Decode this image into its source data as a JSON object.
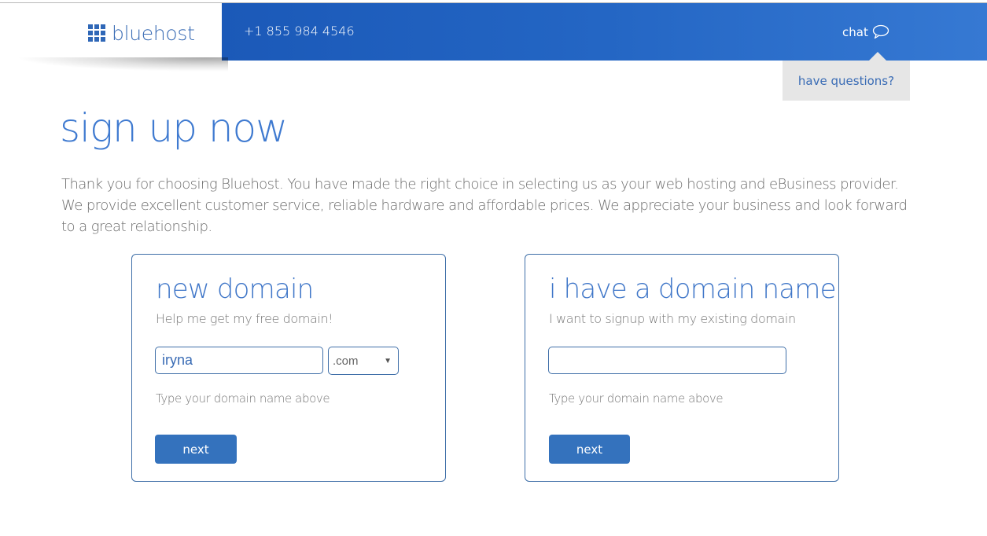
{
  "header": {
    "logo_text": "bluehost",
    "phone": "+1 855 984 4546",
    "chat_label": "chat",
    "chat_icon": "speech-bubble-icon",
    "questions_label": "have questions?"
  },
  "main": {
    "title": "sign up now",
    "intro": "Thank you for choosing Bluehost. You have made the right choice in selecting us as your web hosting and eBusiness provider. We provide excellent customer service, reliable hardware and affordable prices. We appreciate your business and look forward to a great relationship."
  },
  "cards": [
    {
      "title": "new domain",
      "subtitle": "Help me get my free domain!",
      "input_value": "iryna",
      "tld_selected": ".com",
      "hint": "Type your domain name above",
      "button_label": "next"
    },
    {
      "title": "i have a domain name",
      "subtitle": "I want to signup with my existing domain",
      "input_value": "",
      "hint": "Type your domain name above",
      "button_label": "next"
    }
  ],
  "colors": {
    "brand_blue": "#2466c4",
    "accent_text": "#3f7ad0",
    "button": "#3472bd",
    "border": "#3f6fa8"
  }
}
